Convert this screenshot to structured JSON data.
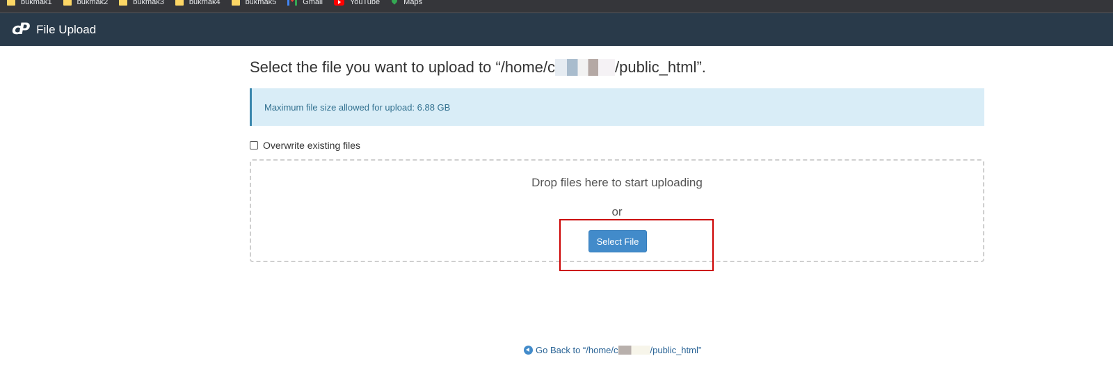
{
  "bookmarks": [
    {
      "label": "bukmak1",
      "icon": "folder-icon"
    },
    {
      "label": "bukmak2",
      "icon": "folder-icon"
    },
    {
      "label": "bukmak3",
      "icon": "folder-icon"
    },
    {
      "label": "bukmak4",
      "icon": "folder-icon"
    },
    {
      "label": "bukmak5",
      "icon": "folder-icon"
    },
    {
      "label": "Gmail",
      "icon": "gmail-icon"
    },
    {
      "label": "YouTube",
      "icon": "youtube-icon"
    },
    {
      "label": "Maps",
      "icon": "maps-icon"
    }
  ],
  "header": {
    "logo": "cP",
    "title": "File Upload"
  },
  "main": {
    "title_prefix": "Select the file you want to upload to “/home/c",
    "title_suffix": "/public_html”.",
    "alert_text": "Maximum file size allowed for upload: 6.88 GB",
    "overwrite_label": "Overwrite existing files",
    "drop_text": "Drop files here to start uploading",
    "or_text": "or",
    "select_button": "Select File",
    "go_back_prefix": "Go Back to “/home/c",
    "go_back_suffix": "/public_html”"
  },
  "colors": {
    "header_bg": "#293a4a",
    "alert_bg": "#d9edf7",
    "button_bg": "#428bca",
    "highlight": "#cc0000"
  }
}
